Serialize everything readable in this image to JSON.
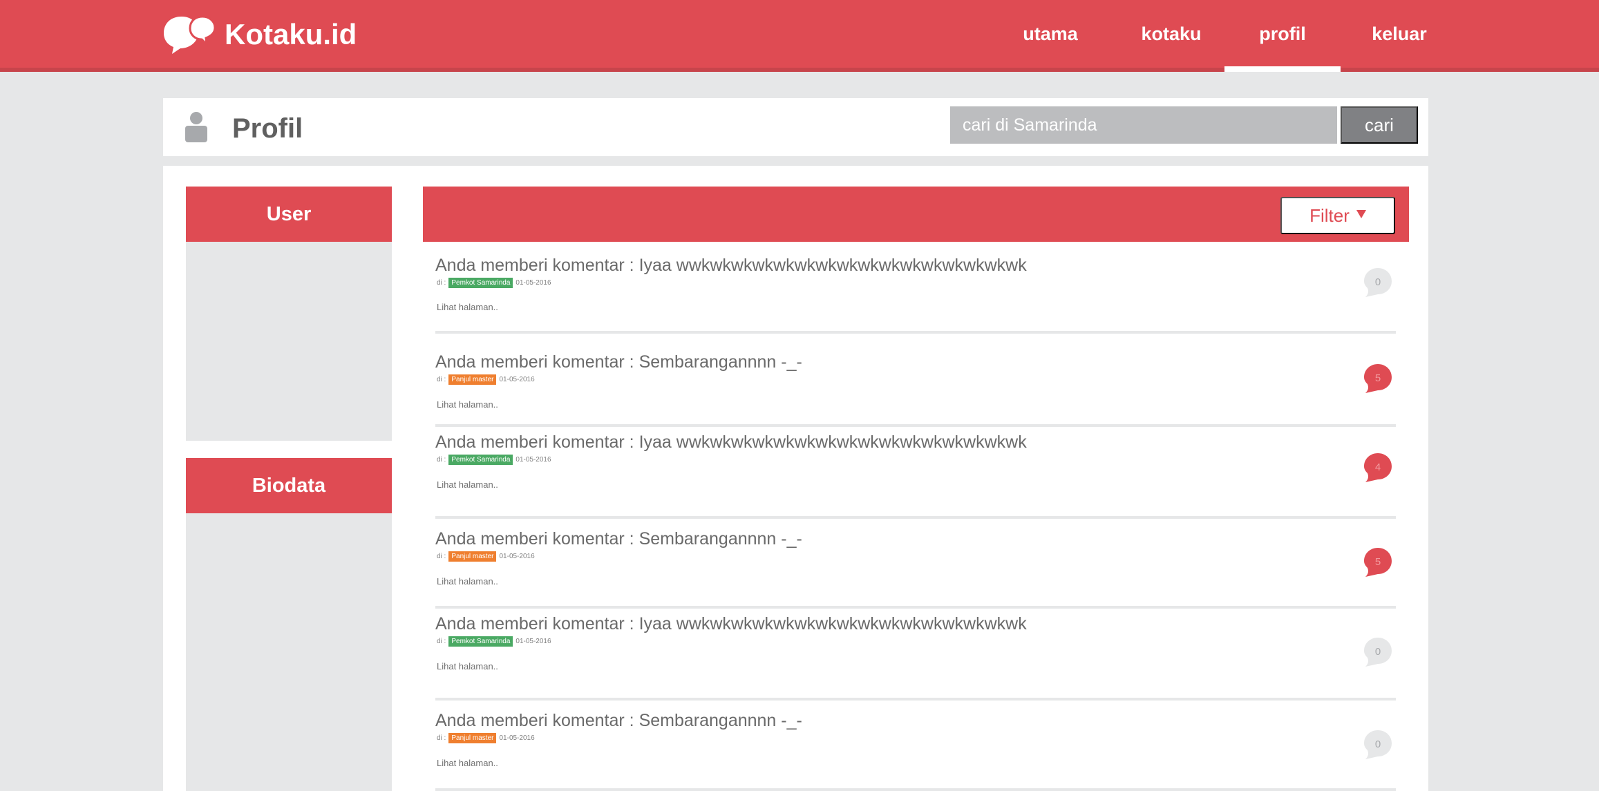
{
  "header": {
    "brand": "Kotaku.id",
    "nav": [
      {
        "label": "utama",
        "active": false
      },
      {
        "label": "kotaku",
        "active": false
      },
      {
        "label": "profil",
        "active": true
      },
      {
        "label": "keluar",
        "active": false
      }
    ]
  },
  "profile_bar": {
    "title": "Profil",
    "search_placeholder": "cari di Samarinda",
    "search_button": "cari"
  },
  "sidebar": {
    "user_label": "User",
    "biodata_label": "Biodata"
  },
  "feed": {
    "filter_label": "Filter",
    "items": [
      {
        "title": "Anda memberi komentar : Iyaa wwkwkwkwkwkwkwkwkwkwkwkwkwkwkwkwk",
        "prefix": "di :",
        "tag": "Pemkot Samarinda",
        "tag_color": "#4aa963",
        "date": "01-05-2016",
        "link": "Lihat halaman..",
        "count": "0",
        "bubble_color": "#e6e7e8",
        "count_color": "#a7a9ac"
      },
      {
        "title": "Anda memberi komentar : Sembarangannnn -_-",
        "prefix": "di :",
        "tag": "Panjul master",
        "tag_color": "#ef7f2f",
        "date": "01-05-2016",
        "link": "Lihat halaman..",
        "count": "5",
        "bubble_color": "#df4b53",
        "count_color": "#f29a9f"
      },
      {
        "title": "Anda memberi komentar : Iyaa wwkwkwkwkwkwkwkwkwkwkwkwkwkwkwkwk",
        "prefix": "di :",
        "tag": "Pemkot Samarinda",
        "tag_color": "#4aa963",
        "date": "01-05-2016",
        "link": "Lihat halaman..",
        "count": "4",
        "bubble_color": "#df4b53",
        "count_color": "#f29a9f"
      },
      {
        "title": "Anda memberi komentar : Sembarangannnn -_-",
        "prefix": "di :",
        "tag": "Panjul master",
        "tag_color": "#ef7f2f",
        "date": "01-05-2016",
        "link": "Lihat halaman..",
        "count": "5",
        "bubble_color": "#df4b53",
        "count_color": "#f29a9f"
      },
      {
        "title": "Anda memberi komentar : Iyaa wwkwkwkwkwkwkwkwkwkwkwkwkwkwkwkwk",
        "prefix": "di :",
        "tag": "Pemkot Samarinda",
        "tag_color": "#4aa963",
        "date": "01-05-2016",
        "link": "Lihat halaman..",
        "count": "0",
        "bubble_color": "#e6e7e8",
        "count_color": "#a7a9ac"
      },
      {
        "title": "Anda memberi komentar : Sembarangannnn -_-",
        "prefix": "di :",
        "tag": "Panjul master",
        "tag_color": "#ef7f2f",
        "date": "01-05-2016",
        "link": "Lihat halaman..",
        "count": "0",
        "bubble_color": "#e6e7e8",
        "count_color": "#a7a9ac"
      }
    ]
  },
  "colors": {
    "brand_red": "#df4b53",
    "background_gray": "#e6e7e8",
    "search_gray": "#bcbdbf",
    "button_gray": "#808184"
  }
}
